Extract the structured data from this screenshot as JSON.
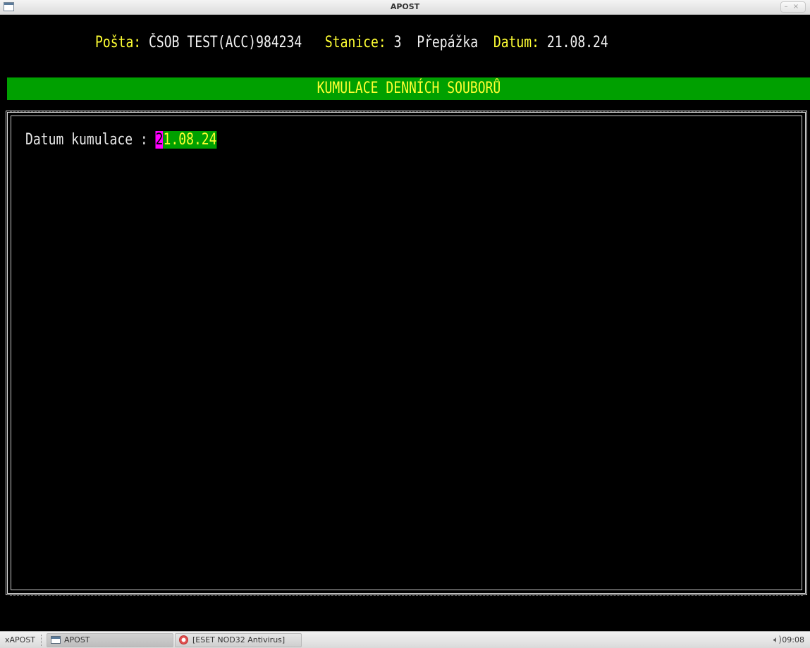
{
  "window": {
    "title": "APOST",
    "btn_minimize": "–",
    "btn_close": "×"
  },
  "status": {
    "posta_label": "Pošta:",
    "posta_value": "ČSOB TEST(ACC)984234",
    "stanice_label": "Stanice:",
    "stanice_value": "3",
    "prepazka_label": "Přepážka",
    "datum_label": "Datum:",
    "datum_value": "21.08.24"
  },
  "screen": {
    "banner": "KUMULACE DENNÍCH SOUBORŮ",
    "field_label": "Datum kumulace :",
    "field_value_cursor": "2",
    "field_value_rest": "1.08.24"
  },
  "colors": {
    "label_yellow": "#ffff33",
    "banner_green": "#00a000",
    "cursor_magenta": "#ff00ff"
  },
  "taskbar": {
    "menu_label": "xAPOST",
    "task_apost": "APOST",
    "task_eset": "[ESET NOD32 Antivirus]",
    "volume_icon": "volume-icon",
    "clock": "09:08"
  }
}
